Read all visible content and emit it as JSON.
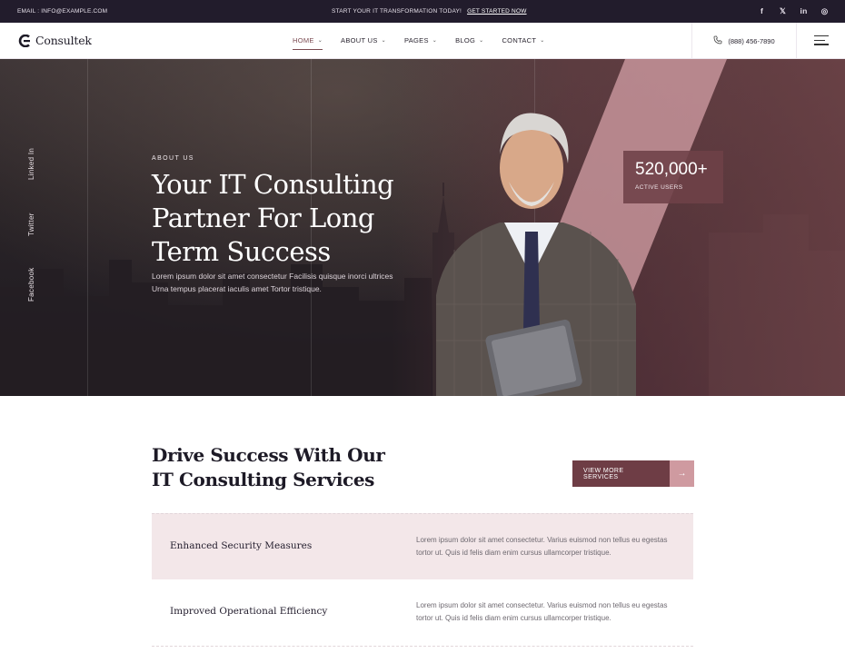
{
  "topbar": {
    "email": "EMAIL : INFO@EXAMPLE.COM",
    "promo_text": "START YOUR IT TRANSFORMATION TODAY!",
    "promo_link": "GET STARTED NOW",
    "social": [
      "f",
      "𝕏",
      "in",
      "◎"
    ]
  },
  "header": {
    "brand": "Consultek",
    "nav": [
      {
        "label": "HOME"
      },
      {
        "label": "ABOUT US"
      },
      {
        "label": "PAGES"
      },
      {
        "label": "BLOG"
      },
      {
        "label": "CONTACT"
      }
    ],
    "phone": "(888) 456-7890"
  },
  "hero": {
    "social_vertical": [
      "Linked In",
      "Twitter",
      "Facebook"
    ],
    "eyebrow": "ABOUT US",
    "title": "Your IT Consulting Partner For Long Term Success",
    "lead": "Lorem ipsum dolor sit amet consectetur Facilisis quisque inorci ultrices Urna tempus placerat iaculis amet Tortor tristique.",
    "stat_value": "520,000+",
    "stat_label": "ACTIVE USERS"
  },
  "services": {
    "title": "Drive Success With Our IT Consulting Services",
    "button_label": "VIEW MORE SERVICES",
    "items": [
      {
        "title": "Enhanced Security Measures",
        "desc": "Lorem ipsum dolor sit amet consectetur. Varius euismod non tellus eu egestas tortor ut. Quis id felis diam enim cursus ullamcorper tristique."
      },
      {
        "title": "Improved Operational Efficiency",
        "desc": "Lorem ipsum dolor sit amet consectetur. Varius euismod non tellus eu egestas tortor ut. Quis id felis diam enim cursus ullamcorper tristique."
      }
    ]
  },
  "colors": {
    "topbar_bg": "#221c2c",
    "accent": "#6e3d45",
    "accent_light": "#cf9aa0",
    "row_tint": "#f3e7e9"
  }
}
